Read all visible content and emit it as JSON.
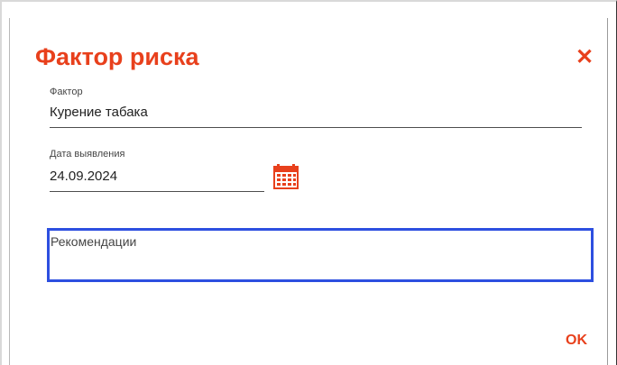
{
  "dialog": {
    "title": "Фактор риска",
    "close_icon": "close-icon",
    "ok_label": "OK"
  },
  "fields": {
    "factor": {
      "label": "Фактор",
      "value": "Курение табака"
    },
    "date": {
      "label": "Дата выявления",
      "value": "24.09.2024",
      "icon": "calendar-icon"
    },
    "recommendations": {
      "label": "Рекомендации"
    }
  },
  "colors": {
    "accent": "#e8401c",
    "focus_border": "#2d4fe0"
  }
}
